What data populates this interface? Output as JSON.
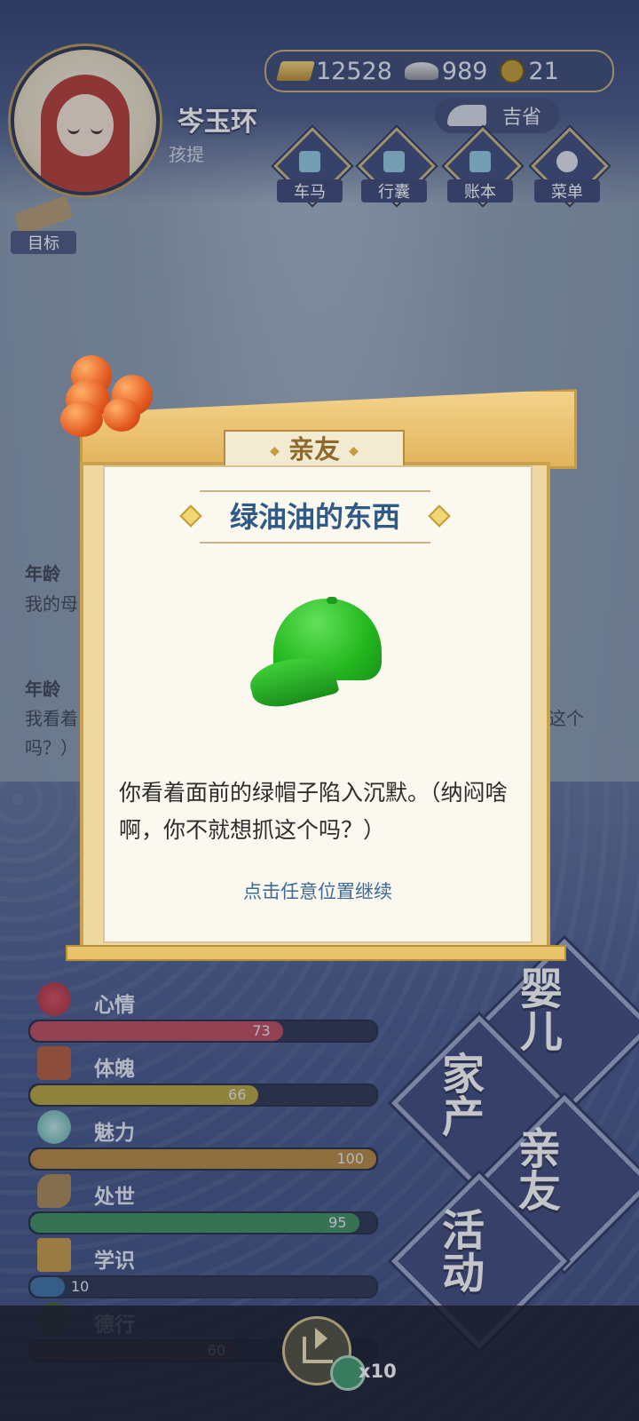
{
  "player": {
    "name": "岑玉环",
    "stage": "孩提"
  },
  "currency": {
    "gold": "12528",
    "silver": "989",
    "coins": "21"
  },
  "luck": {
    "label": "吉省"
  },
  "nav": [
    {
      "label": "车马"
    },
    {
      "label": "行囊"
    },
    {
      "label": "账本"
    },
    {
      "label": "菜单"
    }
  ],
  "goal": {
    "label": "目标"
  },
  "log": [
    {
      "age": "年龄",
      "text": "我的母"
    },
    {
      "age": "年龄",
      "text": "我看着",
      "text2": "吗？）",
      "tail": "这个"
    }
  ],
  "dialog": {
    "category": "亲友",
    "title": "绿油油的东西",
    "description": "你看着面前的绿帽子陷入沉默。（纳闷啥啊，你不就想抓这个吗？）",
    "hint": "点击任意位置继续"
  },
  "stats": [
    {
      "label": "心情",
      "value": "73",
      "percent": 73,
      "color": "#c0485e"
    },
    {
      "label": "体魄",
      "value": "66",
      "percent": 66,
      "color": "#b7a23a"
    },
    {
      "label": "魅力",
      "value": "100",
      "percent": 100,
      "color": "#b8873d"
    },
    {
      "label": "处世",
      "value": "95",
      "percent": 95,
      "color": "#3d8e5a"
    },
    {
      "label": "学识",
      "value": "10",
      "percent": 10,
      "color": "#3b6fa6"
    },
    {
      "label": "德行",
      "value": "60",
      "percent": 60,
      "color": "#4b2a48"
    }
  ],
  "categories": {
    "baby": "婴儿",
    "property": "家产",
    "friends": "亲友",
    "activity": "活动"
  },
  "bottom": {
    "reward": "x10"
  },
  "colors": {
    "dialog_title": "#2f5a86",
    "hint": "#3d6a98",
    "gold_frame": "#caa14c"
  }
}
